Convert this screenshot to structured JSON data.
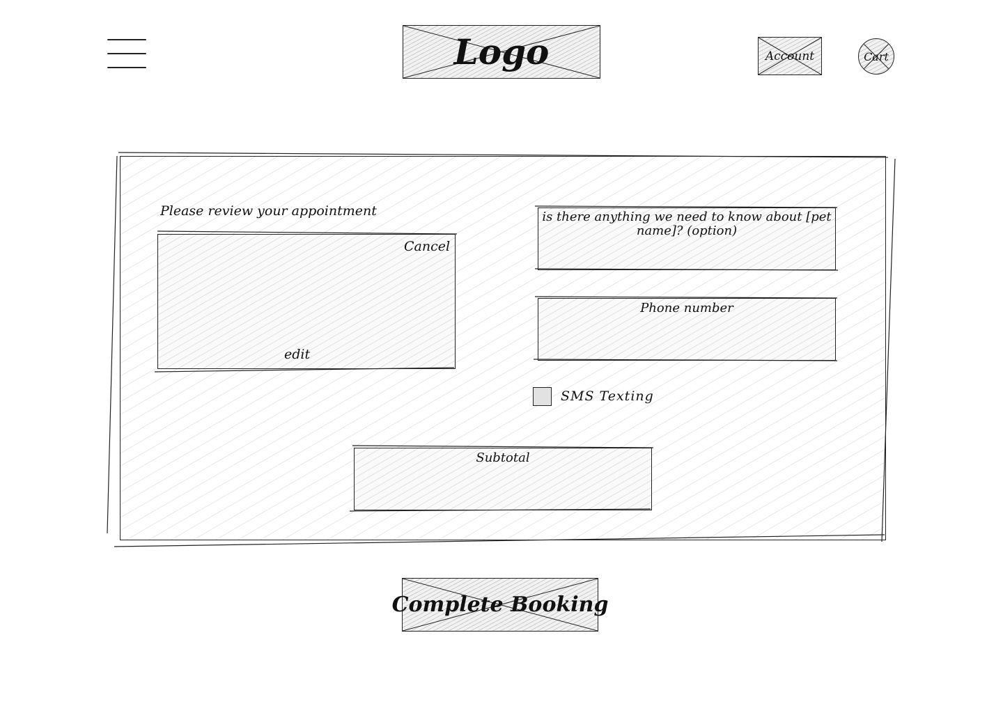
{
  "header": {
    "logo_text": "Logo",
    "account_label": "Account",
    "cart_label": "Cart"
  },
  "review": {
    "title": "Please review your appointment",
    "cancel_label": "Cancel",
    "edit_label": "edit"
  },
  "form": {
    "notes_label": "is there anything we need to know about [pet name]? (option)",
    "phone_label": "Phone number",
    "sms_label": "SMS Texting",
    "sms_checked": false
  },
  "summary": {
    "subtotal_label": "Subtotal"
  },
  "footer": {
    "complete_label": "Complete Booking"
  }
}
